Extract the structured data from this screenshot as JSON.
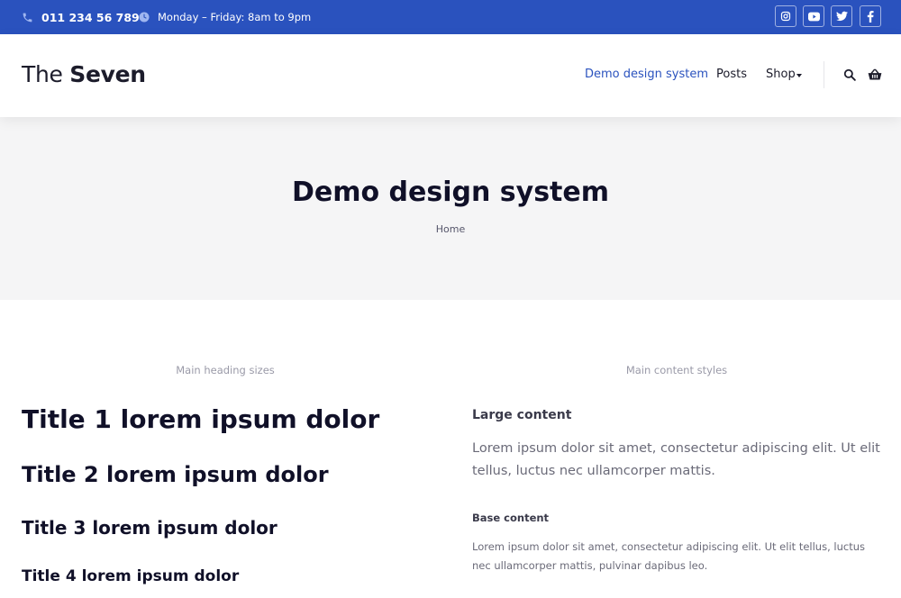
{
  "topbar": {
    "phone": "011 234 56 789",
    "hours": "Monday – Friday: 8am to 9pm",
    "icons": [
      "phone-icon",
      "clock-icon",
      "instagram-icon",
      "youtube-icon",
      "twitter-icon",
      "facebook-icon"
    ]
  },
  "header": {
    "logo_light": "The ",
    "logo_bold": "Seven",
    "nav": [
      "Demo design system",
      "Posts",
      "Shop"
    ],
    "icons": [
      "search-icon",
      "basket-icon"
    ]
  },
  "hero": {
    "title": "Demo design system",
    "breadcrumb": "Home"
  },
  "main": {
    "left_label": "Main heading sizes",
    "right_label": "Main content styles",
    "titles": [
      "Title 1 lorem ipsum dolor",
      "Title 2 lorem ipsum dolor",
      "Title 3 lorem ipsum dolor",
      "Title 4 lorem ipsum dolor"
    ],
    "large_heading": "Large content",
    "large_text": "Lorem ipsum dolor sit amet, consectetur adipiscing elit. Ut elit tellus, luctus nec ullamcorper mattis.",
    "base_heading": "Base content",
    "base_text": "Lorem ipsum dolor sit amet, consectetur adipiscing elit. Ut elit tellus, luctus nec ullamcorper mattis, pulvinar dapibus leo."
  },
  "colors": {
    "brand_blue": "#2a52be",
    "hero_bg": "#f5f5f6",
    "heading": "#101028",
    "muted": "#9a9aa8"
  }
}
